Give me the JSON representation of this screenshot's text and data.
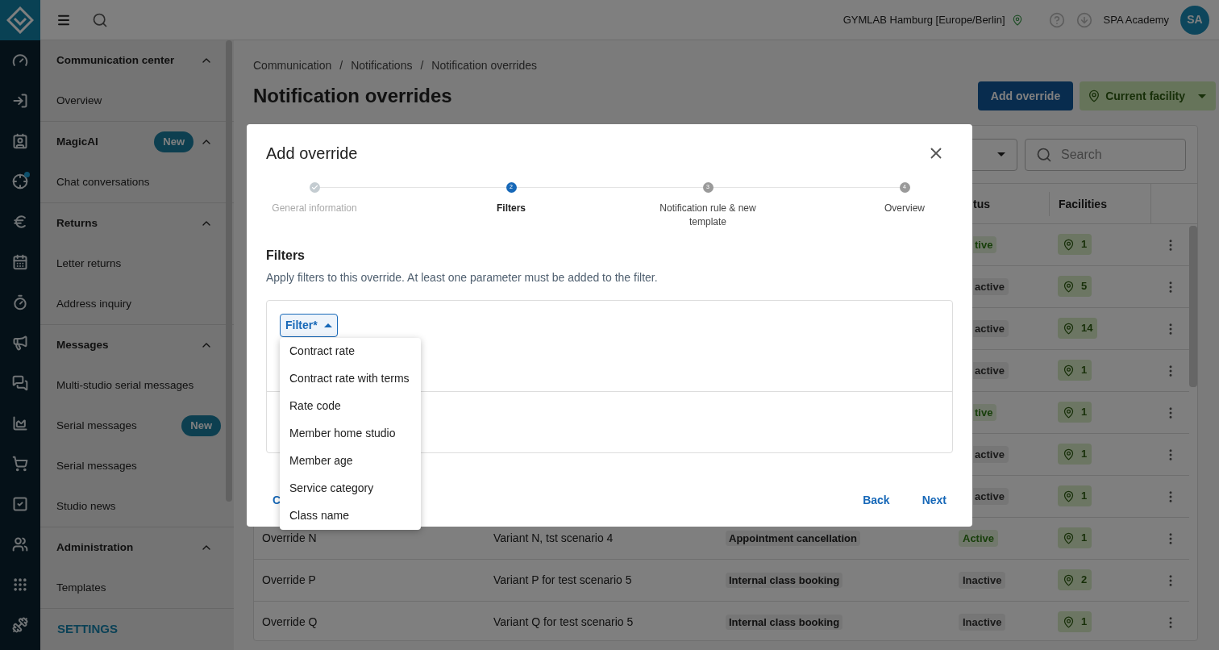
{
  "topbar": {
    "location": "GYMLAB Hamburg [Europe/Berlin]",
    "account": "SPA Academy",
    "avatar": "SA"
  },
  "rail": [
    {
      "kind": "gauge"
    },
    {
      "kind": "login"
    },
    {
      "kind": "contact"
    },
    {
      "kind": "target",
      "dot": true
    },
    {
      "kind": "euro"
    },
    {
      "kind": "calendar"
    },
    {
      "kind": "timer"
    },
    {
      "kind": "megaphone"
    },
    {
      "kind": "chat"
    },
    {
      "kind": "chart"
    },
    {
      "kind": "cart"
    },
    {
      "kind": "check"
    },
    {
      "kind": "users"
    },
    {
      "kind": "grid"
    },
    {
      "kind": "dumbbell"
    }
  ],
  "sidebar": {
    "sections": [
      {
        "title": "Communication center",
        "expanded": true,
        "items": [
          {
            "label": "Overview"
          }
        ]
      },
      {
        "title": "MagicAI",
        "badge": "New",
        "expanded": true,
        "items": [
          {
            "label": "Chat conversations"
          }
        ]
      },
      {
        "title": "Returns",
        "expanded": true,
        "items": [
          {
            "label": "Letter returns"
          },
          {
            "label": "Address inquiry"
          }
        ]
      },
      {
        "title": "Messages",
        "expanded": true,
        "items": [
          {
            "label": "Multi-studio serial messages"
          },
          {
            "label": "Serial messages",
            "badge": "New"
          },
          {
            "label": "Serial messages"
          },
          {
            "label": "Studio news"
          }
        ]
      },
      {
        "title": "Administration",
        "expanded": true,
        "items": [
          {
            "label": "Templates"
          }
        ]
      }
    ],
    "footer": "SETTINGS"
  },
  "breadcrumbs": [
    {
      "label": "Communication"
    },
    {
      "separator": "/",
      "label": "Notifications"
    },
    {
      "separator": "/",
      "label": "Notification overrides"
    }
  ],
  "page_title": "Notification overrides",
  "actions": {
    "add": "Add override",
    "facility": "Current facility"
  },
  "table": {
    "search_placeholder": "Search",
    "columns": [
      "tus",
      "Facilities"
    ],
    "rows": [
      {
        "clipped": true,
        "status": "tive",
        "active": true,
        "facilities": "1"
      },
      {
        "clipped": true,
        "status": "active",
        "active": false,
        "facilities": "5"
      },
      {
        "clipped": true,
        "status": "active",
        "active": false,
        "facilities": "14"
      },
      {
        "clipped": true,
        "status": "active",
        "active": false,
        "facilities": "1"
      },
      {
        "clipped": true,
        "status": "tive",
        "active": true,
        "facilities": "1"
      },
      {
        "clipped": true,
        "status": "active",
        "active": false,
        "facilities": "1"
      },
      {
        "clipped": true,
        "status": "active",
        "active": false,
        "facilities": "1"
      },
      {
        "clipped": false,
        "name": "Override N",
        "variant": "Variant N, tst scenario 4",
        "type": "Appointment cancellation",
        "status": "Active",
        "active": true,
        "facilities": "1"
      },
      {
        "clipped": false,
        "name": "Override P",
        "variant": "Variant P for test scenario 5",
        "type": "Internal class booking",
        "status": "Inactive",
        "active": false,
        "facilities": "2"
      },
      {
        "clipped": false,
        "name": "Override Q",
        "variant": "Variant Q for test scenario 5",
        "type": "Internal class booking",
        "status": "Inactive",
        "active": false,
        "facilities": "1"
      }
    ]
  },
  "dialog": {
    "title": "Add override",
    "steps": [
      {
        "label": "General information",
        "done": true,
        "selected": false
      },
      {
        "label": "Filters",
        "number": "2",
        "done": false,
        "selected": true
      },
      {
        "label": "Notification rule & new template",
        "number": "3",
        "done": false,
        "selected": false
      },
      {
        "label": "Overview",
        "number": "4",
        "done": false,
        "selected": false
      }
    ],
    "heading": "Filters",
    "description": "Apply filters to this override. At least one parameter must be added to the filter.",
    "filter_button": "Filter*",
    "menu_open": true,
    "menu": [
      {
        "label": "Contract rate"
      },
      {
        "label": "Contract rate with terms"
      },
      {
        "label": "Rate code"
      },
      {
        "label": "Member home studio"
      },
      {
        "label": "Member age"
      },
      {
        "label": "Service category"
      },
      {
        "label": "Class name"
      }
    ],
    "cancel": "C",
    "back": "Back",
    "next": "Next"
  }
}
